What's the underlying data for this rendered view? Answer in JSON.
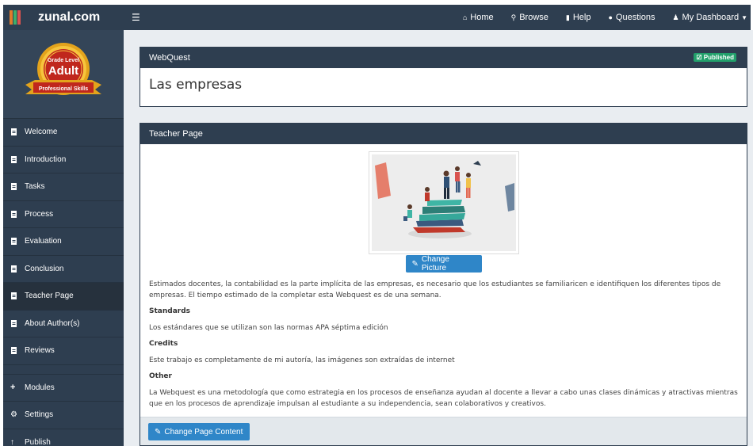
{
  "brand": {
    "name": "zunal.com"
  },
  "nav": {
    "menu_icon": "hamburger-icon",
    "links": [
      {
        "label": "Home",
        "icon": "home-icon"
      },
      {
        "label": "Browse",
        "icon": "search-icon"
      },
      {
        "label": "Help",
        "icon": "book-icon"
      },
      {
        "label": "Questions",
        "icon": "comments-icon"
      },
      {
        "label": "My Dashboard",
        "icon": "user-icon"
      }
    ]
  },
  "sidebar": {
    "badge": {
      "top": "Grade Level",
      "main": "Adult",
      "ribbon": "Professional Skills"
    },
    "items": [
      {
        "label": "Welcome",
        "icon": "file-icon"
      },
      {
        "label": "Introduction",
        "icon": "file-icon"
      },
      {
        "label": "Tasks",
        "icon": "file-icon"
      },
      {
        "label": "Process",
        "icon": "file-icon"
      },
      {
        "label": "Evaluation",
        "icon": "file-icon"
      },
      {
        "label": "Conclusion",
        "icon": "file-icon"
      },
      {
        "label": "Teacher Page",
        "icon": "file-icon",
        "active": true
      },
      {
        "label": "About Author(s)",
        "icon": "file-icon"
      },
      {
        "label": "Reviews",
        "icon": "file-icon"
      }
    ],
    "tools": [
      {
        "label": "Modules",
        "icon": "plus-icon"
      },
      {
        "label": "Settings",
        "icon": "gear-icon"
      },
      {
        "label": "Publish",
        "icon": "upload-icon"
      }
    ]
  },
  "webquest": {
    "header": "WebQuest",
    "status": "Published",
    "title": "Las empresas"
  },
  "teacher": {
    "header": "Teacher Page",
    "change_picture": "Change Picture",
    "intro": "Estimados  docentes, la contabilidad es la parte implícita de las empresas, es necesario que los estudiantes se familiaricen e identifiquen los diferentes tipos de empresas. El tiempo estimado de la completar esta Webquest es de una semana.",
    "standards_title": "Standards",
    "standards_text": "Los estándares que se utilizan son las normas APA séptima edición",
    "credits_title": "Credits",
    "credits_text": "Este trabajo es completamente de mi autoría, las imágenes son extraídas de internet",
    "other_title": "Other",
    "other_text": "La Webquest es una metodología que como estrategia en los procesos de enseñanza ayudan al docente  a llevar a cabo unas clases dinámicas y atractivas mientras que en los procesos de aprendizaje impulsan al estudiante a su independencia, sean colaborativos y creativos.",
    "change_content": "Change Page Content"
  },
  "colors": {
    "navbar": "#2e3e50",
    "accent_button": "#2f86c8",
    "published_badge": "#22a06b"
  }
}
